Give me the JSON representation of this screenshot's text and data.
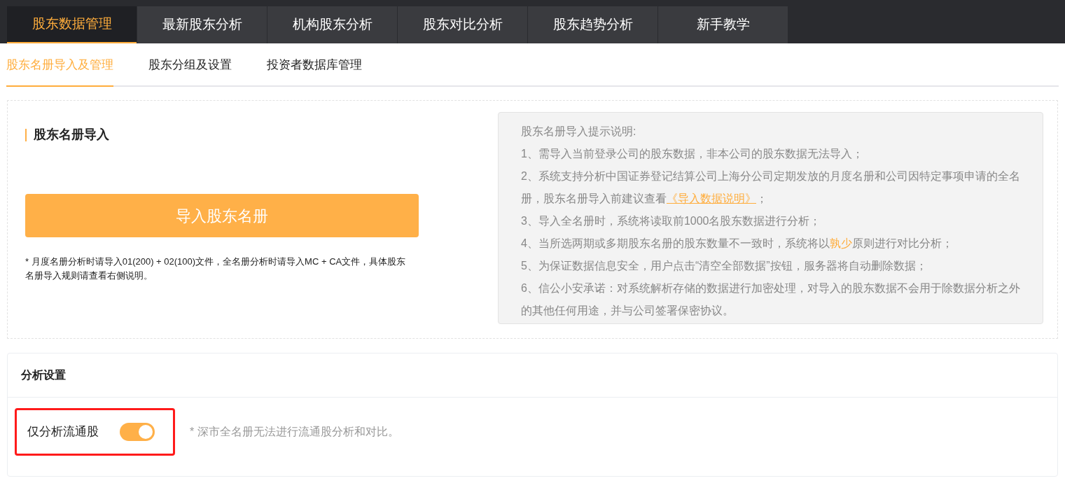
{
  "main_tabs": [
    {
      "label": "股东数据管理",
      "selected": true
    },
    {
      "label": "最新股东分析",
      "selected": false
    },
    {
      "label": "机构股东分析",
      "selected": false
    },
    {
      "label": "股东对比分析",
      "selected": false
    },
    {
      "label": "股东趋势分析",
      "selected": false
    },
    {
      "label": "新手教学",
      "selected": false
    }
  ],
  "sub_tabs": [
    {
      "label": "股东名册导入及管理",
      "selected": true
    },
    {
      "label": "股东分组及设置",
      "selected": false
    },
    {
      "label": "投资者数据库管理",
      "selected": false
    }
  ],
  "import_panel": {
    "title": "股东名册导入",
    "button": "导入股东名册",
    "note": "* 月度名册分析时请导入01(200) + 02(100)文件，全名册分析时请导入MC + CA文件，具体股东名册导入规则请查看右侧说明。"
  },
  "instructions": {
    "title": "股东名册导入提示说明:",
    "items": [
      [
        {
          "kind": "text",
          "text": "1、需导入当前登录公司的股东数据，非本公司的股东数据无法导入；"
        }
      ],
      [
        {
          "kind": "text",
          "text": "2、系统支持分析中国证券登记结算公司上海分公司定期发放的月度名册和公司因特定事项申请的全名册，股东名册导入前建议查看"
        },
        {
          "kind": "link",
          "text": "《导入数据说明》"
        },
        {
          "kind": "text",
          "text": "；"
        }
      ],
      [
        {
          "kind": "text",
          "text": "3、导入全名册时，系统将读取前1000名股东数据进行分析；"
        }
      ],
      [
        {
          "kind": "text",
          "text": "4、当所选两期或多期股东名册的股东数量不一致时，系统将以"
        },
        {
          "kind": "highlight",
          "text": "孰少"
        },
        {
          "kind": "text",
          "text": "原则进行对比分析；"
        }
      ],
      [
        {
          "kind": "text",
          "text": "5、为保证数据信息安全，用户点击“清空全部数据”按钮，服务器将自动删除数据；"
        }
      ],
      [
        {
          "kind": "text",
          "text": "6、信公小安承诺：对系统解析存储的数据进行加密处理，对导入的股东数据不会用于除数据分析之外的其他任何用途，并与公司签署保密协议。"
        }
      ]
    ]
  },
  "settings": {
    "title": "分析设置",
    "label": "仅分析流通股",
    "on": true,
    "highlighted": true,
    "note": "* 深市全名册无法进行流通股分析和对比。"
  }
}
